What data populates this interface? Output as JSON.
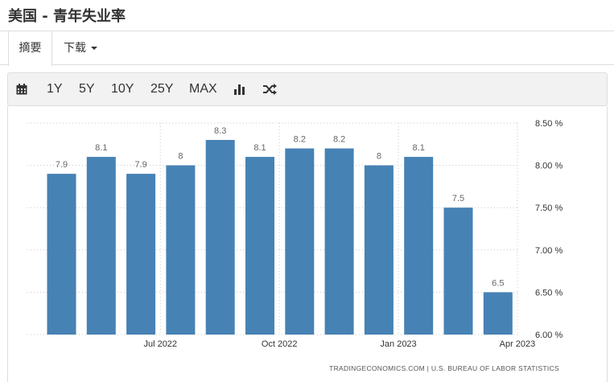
{
  "page": {
    "title": "美国 - 青年失业率"
  },
  "tabs": [
    {
      "label": "摘要"
    },
    {
      "label": "下载"
    }
  ],
  "toolbar": {
    "calendar_icon": "calendar-icon",
    "ranges": [
      "1Y",
      "5Y",
      "10Y",
      "25Y",
      "MAX"
    ],
    "chart_type_icon": "bar-chart-icon",
    "compare_icon": "shuffle-icon"
  },
  "chart_data": {
    "type": "bar",
    "title": "",
    "xlabel": "",
    "ylabel": "",
    "categories": [
      "2022-05",
      "2022-06",
      "2022-07",
      "2022-08",
      "2022-09",
      "2022-10",
      "2022-11",
      "2022-12",
      "2023-01",
      "2023-02",
      "2023-03",
      "2023-04"
    ],
    "values": [
      7.9,
      8.1,
      7.9,
      8,
      8.3,
      8.1,
      8.2,
      8.2,
      8,
      8.1,
      7.5,
      6.5
    ],
    "value_labels": [
      "7.9",
      "8.1",
      "7.9",
      "8",
      "8.3",
      "8.1",
      "8.2",
      "8.2",
      "8",
      "8.1",
      "7.5",
      "6.5"
    ],
    "x_tick_labels": [
      {
        "at": "2022-07",
        "label": "Jul 2022"
      },
      {
        "at": "2022-10",
        "label": "Oct 2022"
      },
      {
        "at": "2023-01",
        "label": "Jan 2023"
      },
      {
        "at": "2023-04",
        "label": "Apr 2023"
      }
    ],
    "y_ticks": [
      6.0,
      6.5,
      7.0,
      7.5,
      8.0,
      8.5
    ],
    "y_tick_labels": [
      "6.00 %",
      "6.50 %",
      "7.00 %",
      "7.50 %",
      "8.00 %",
      "8.50 %"
    ],
    "ylim": [
      6.0,
      8.5
    ],
    "grid": true,
    "bar_color": "#4682b4",
    "source": "TRADINGECONOMICS.COM | U.S. BUREAU OF LABOR STATISTICS"
  }
}
